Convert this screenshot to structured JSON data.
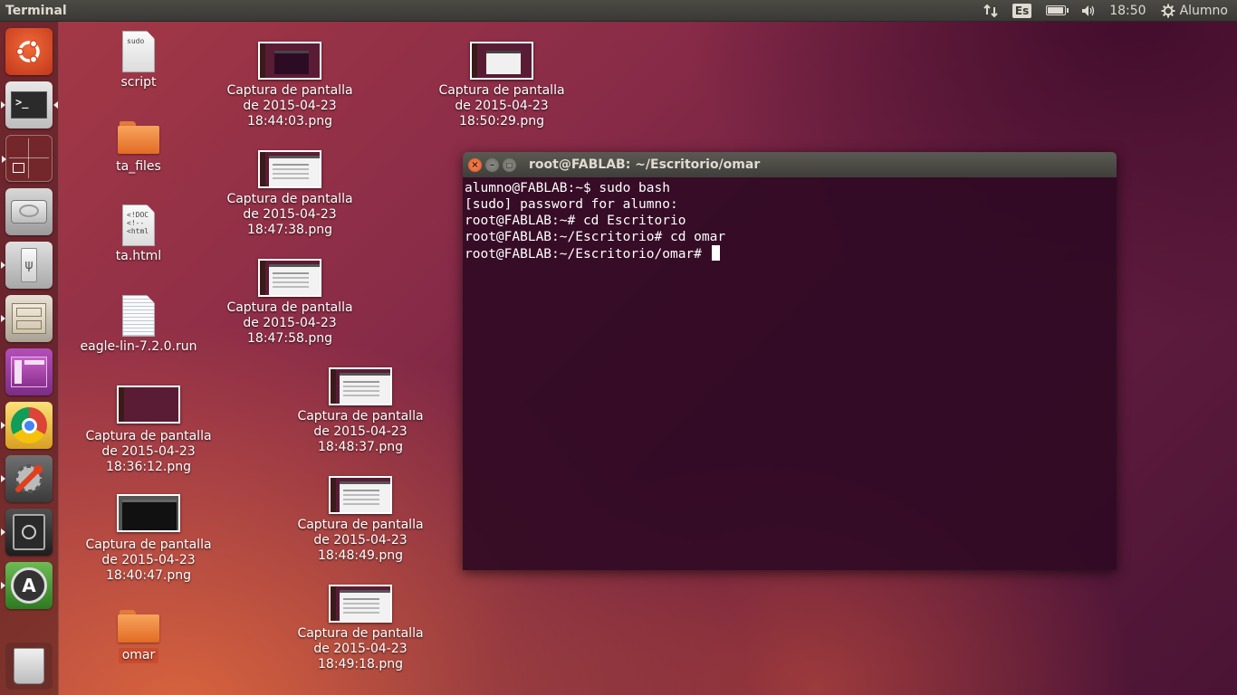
{
  "top_panel": {
    "app_title": "Terminal",
    "keyboard_layout": "Es",
    "clock": "18:50",
    "user": "Alumno",
    "battery_level": 0.85
  },
  "launcher": {
    "items": [
      {
        "name": "dash-home",
        "icon": "ubuntu-logo-icon"
      },
      {
        "name": "terminal",
        "icon": "terminal-icon",
        "active": true
      },
      {
        "name": "workspace-switcher",
        "icon": "workspace-icon"
      },
      {
        "name": "disk-drive",
        "icon": "hard-drive-icon"
      },
      {
        "name": "usb-drive",
        "icon": "usb-icon"
      },
      {
        "name": "file-manager",
        "icon": "file-cabinet-icon"
      },
      {
        "name": "software-center",
        "icon": "software-center-icon"
      },
      {
        "name": "chrome",
        "icon": "chrome-icon"
      },
      {
        "name": "system-settings",
        "icon": "settings-wrench-icon"
      },
      {
        "name": "vault",
        "icon": "safe-icon"
      },
      {
        "name": "software-updater",
        "icon": "updater-icon"
      },
      {
        "name": "trash",
        "icon": "trash-icon"
      }
    ]
  },
  "desktop": {
    "script": "script",
    "ta_files": "ta_files",
    "ta_html": "ta.html",
    "eagle": "eagle-lin-7.2.0.run",
    "cap_1844": "Captura de pantalla\nde 2015-04-23\n18:44:03.png",
    "cap_1850": "Captura de pantalla\nde 2015-04-23\n18:50:29.png",
    "cap_18473": "Captura de pantalla\nde 2015-04-23\n18:47:38.png",
    "cap_18475": "Captura de pantalla\nde 2015-04-23\n18:47:58.png",
    "cap_1836": "Captura de pantalla\nde 2015-04-23\n18:36:12.png",
    "cap_18483": "Captura de pantalla\nde 2015-04-23\n18:48:37.png",
    "cap_1840": "Captura de pantalla\nde 2015-04-23\n18:40:47.png",
    "cap_18484": "Captura de pantalla\nde 2015-04-23\n18:48:49.png",
    "omar": "omar",
    "cap_1849": "Captura de pantalla\nde 2015-04-23\n18:49:18.png",
    "script_doc_text": "sudo",
    "html_doc_text": "<!DOC\n<!--\n<html"
  },
  "terminal": {
    "title": "root@FABLAB: ~/Escritorio/omar",
    "lines": [
      "alumno@FABLAB:~$ sudo bash",
      "[sudo] password for alumno:",
      "root@FABLAB:~# cd Escritorio",
      "root@FABLAB:~/Escritorio# cd omar",
      "root@FABLAB:~/Escritorio/omar# "
    ]
  }
}
